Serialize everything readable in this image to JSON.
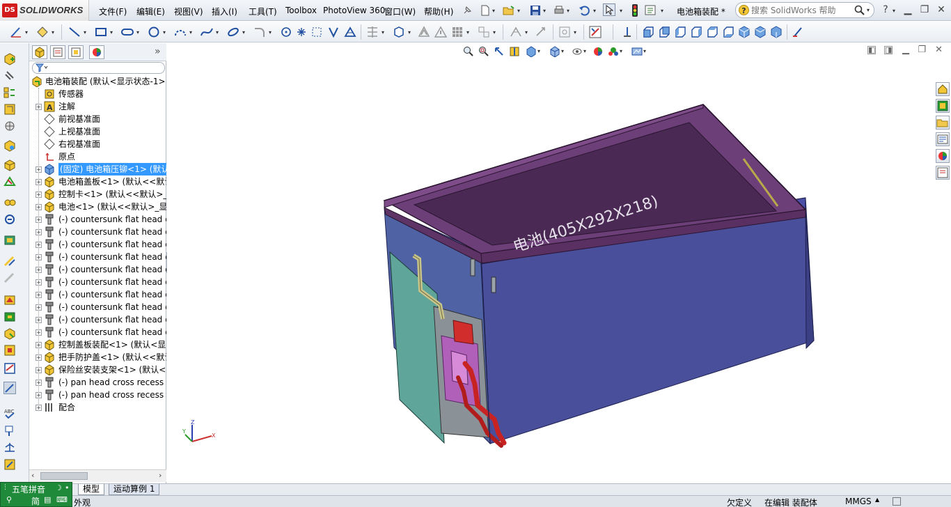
{
  "app": {
    "logo_badge": "DS",
    "logo_text": "SOLIDWORKS"
  },
  "menu": [
    "文件(F)",
    "编辑(E)",
    "视图(V)",
    "插入(I)",
    "工具(T)",
    "Toolbox",
    "PhotoView 360",
    "窗口(W)",
    "帮助(H)"
  ],
  "document_title": "电池箱装配 *",
  "help_search": {
    "placeholder": "搜索 SolidWorks 帮助",
    "question_icon": "?"
  },
  "feature_tree": {
    "root": "电池箱装配 (默认<显示状态-1>",
    "items": [
      {
        "label": "传感器",
        "icon": "sensor-icon",
        "expandable": false
      },
      {
        "label": "注解",
        "icon": "annotation-icon",
        "expandable": true
      },
      {
        "label": "前视基准面",
        "icon": "plane-icon",
        "expandable": false
      },
      {
        "label": "上视基准面",
        "icon": "plane-icon",
        "expandable": false
      },
      {
        "label": "右视基准面",
        "icon": "plane-icon",
        "expandable": false
      },
      {
        "label": "原点",
        "icon": "origin-icon",
        "expandable": false
      },
      {
        "label": "(固定) 电池箱压铆<1> (默认",
        "icon": "part-icon",
        "expandable": true,
        "selected": true
      },
      {
        "label": "电池箱盖板<1> (默认<<默认",
        "icon": "assembly-icon",
        "expandable": true
      },
      {
        "label": "控制卡<1> (默认<<默认>_",
        "icon": "assembly-icon",
        "expandable": true
      },
      {
        "label": "电池<1> (默认<<默认>_显",
        "icon": "assembly-icon",
        "expandable": true
      },
      {
        "label": "(-) countersunk flat head c",
        "icon": "screw-icon",
        "expandable": true
      },
      {
        "label": "(-) countersunk flat head c",
        "icon": "screw-icon",
        "expandable": true
      },
      {
        "label": "(-) countersunk flat head c",
        "icon": "screw-icon",
        "expandable": true
      },
      {
        "label": "(-) countersunk flat head c",
        "icon": "screw-icon",
        "expandable": true
      },
      {
        "label": "(-) countersunk flat head c",
        "icon": "screw-icon",
        "expandable": true
      },
      {
        "label": "(-) countersunk flat head c",
        "icon": "screw-icon",
        "expandable": true
      },
      {
        "label": "(-) countersunk flat head c",
        "icon": "screw-icon",
        "expandable": true
      },
      {
        "label": "(-) countersunk flat head c",
        "icon": "screw-icon",
        "expandable": true
      },
      {
        "label": "(-) countersunk flat head c",
        "icon": "screw-icon",
        "expandable": true
      },
      {
        "label": "(-) countersunk flat head c",
        "icon": "screw-icon",
        "expandable": true
      },
      {
        "label": "控制盖板装配<1> (默认<显",
        "icon": "assembly-icon",
        "expandable": true
      },
      {
        "label": "把手防护盖<1> (默认<<默认",
        "icon": "assembly-icon",
        "expandable": true
      },
      {
        "label": "保险丝安装支架<1> (默认<",
        "icon": "assembly-icon",
        "expandable": true
      },
      {
        "label": "(-) pan head cross recess",
        "icon": "screw-icon",
        "expandable": true
      },
      {
        "label": "(-) pan head cross recess",
        "icon": "screw-icon",
        "expandable": true
      },
      {
        "label": "配合",
        "icon": "mates-icon",
        "expandable": true
      }
    ]
  },
  "model_label": "电池(405X292X218)",
  "triad": {
    "x": "X",
    "y": "Y",
    "z": "Z"
  },
  "bottom_tabs": [
    "模型",
    "运动算例 1"
  ],
  "status": {
    "left": "外观",
    "underdefined": "欠定义",
    "editing": "在编辑 装配体",
    "units": "MMGS"
  },
  "ime": {
    "name": "五笔拼音",
    "mode": "简"
  },
  "colors": {
    "accent": "#3399ff",
    "box_body": "#4a4f9c",
    "lid": "#6d3f78",
    "panel": "#5fa59a",
    "cable": "#d22a2a"
  }
}
